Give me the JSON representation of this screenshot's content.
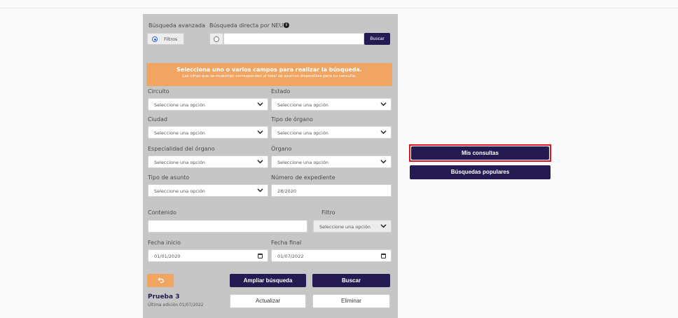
{
  "search_mode": {
    "advanced_label": "Búsqueda avanzada",
    "direct_label": "Búsqueda directa por NEUN",
    "filters_label": "Filtros",
    "direct_value": "",
    "search_button": "Buscar",
    "selected": "advanced"
  },
  "banner": {
    "title": "Selecciona uno o varios campos para realizar la búsqueda.",
    "subtitle": "Las cifras que se muestran corresponden al total de asuntos disponibles para su consulta."
  },
  "fields": {
    "circuito": {
      "label": "Circuito",
      "value": "Seleccione una opción"
    },
    "estado": {
      "label": "Estado",
      "value": "Seleccione una opción"
    },
    "ciudad": {
      "label": "Ciudad",
      "value": "Seleccione una opción"
    },
    "tipo_organo": {
      "label": "Tipo de órgano",
      "value": "Seleccione una opción"
    },
    "especialidad": {
      "label": "Especialidad del órgano",
      "value": "Seleccione una opción"
    },
    "organo": {
      "label": "Órgano",
      "value": "Seleccione una opción"
    },
    "tipo_asunto": {
      "label": "Tipo de asunto",
      "value": "Seleccione una opción"
    },
    "expediente": {
      "label": "Número de expediente",
      "value": "28/2020"
    },
    "contenido": {
      "label": "Contenido",
      "value": ""
    },
    "filtro": {
      "label": "Filtro",
      "value": "Seleccione una opción"
    },
    "fecha_inicio": {
      "label": "Fecha inicio",
      "value": "01/01/2020"
    },
    "fecha_final": {
      "label": "Fecha final",
      "value": "01/07/2022"
    }
  },
  "actions": {
    "ampliar": "Ampliar búsqueda",
    "buscar": "Buscar",
    "actualizar": "Actualizar",
    "eliminar": "Eliminar"
  },
  "saved_query": {
    "name": "Prueba 3",
    "edited": "Última edición 01/07/2022"
  },
  "side": {
    "mis_consultas": "Mis consultas",
    "busquedas_populares": "Búsquedas populares"
  },
  "colors": {
    "primary": "#251b52",
    "accent": "#f0a662",
    "panel": "#c6c6c6",
    "highlight": "#e0141e"
  }
}
